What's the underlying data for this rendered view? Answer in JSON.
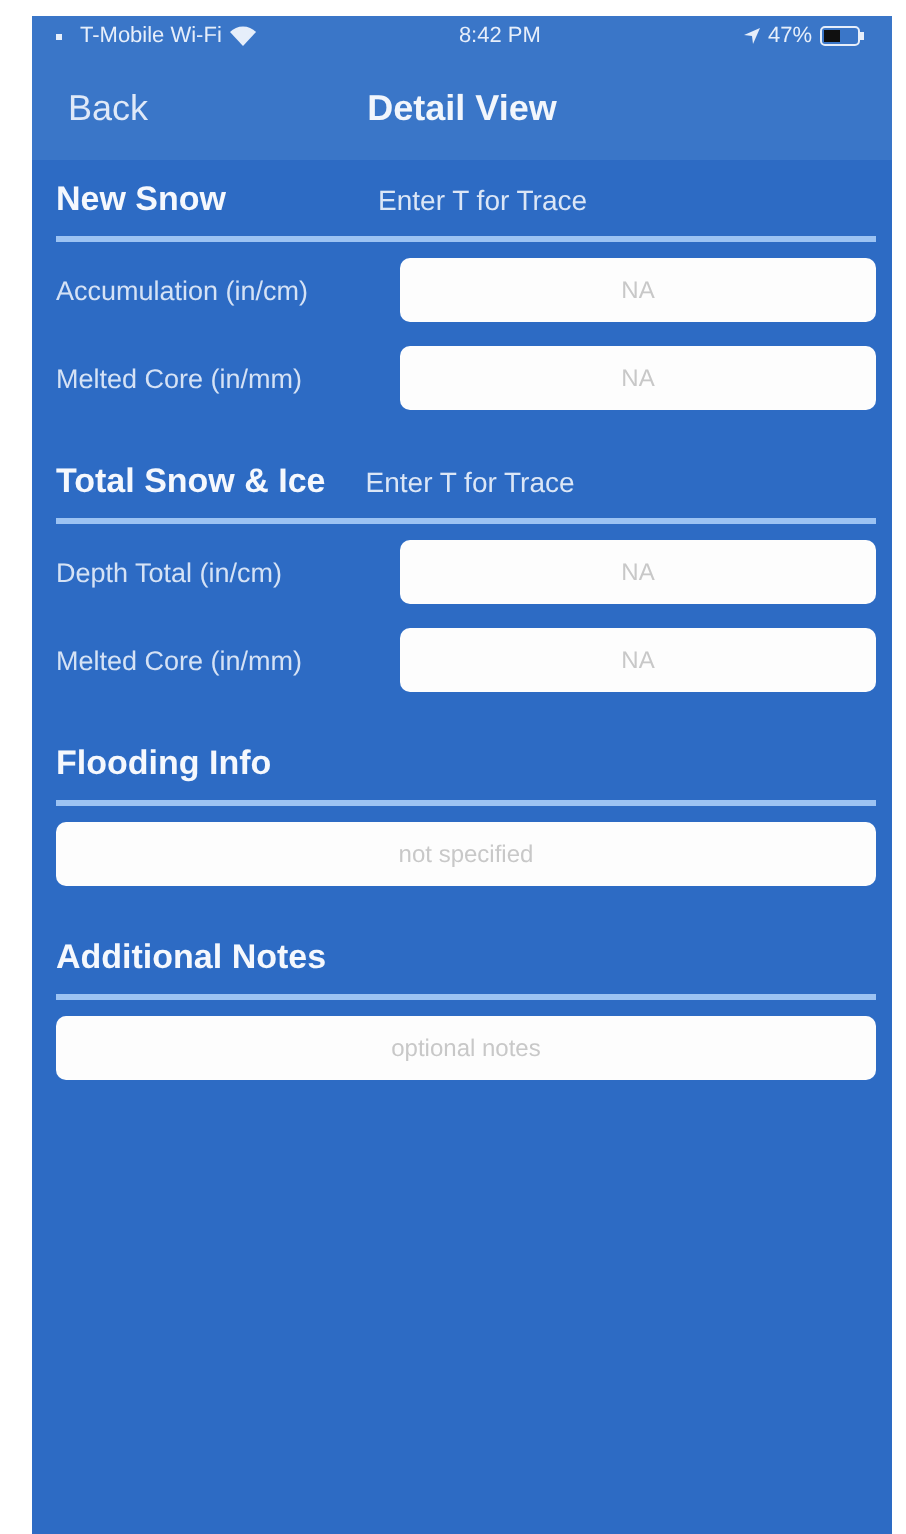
{
  "status_bar": {
    "carrier": "T-Mobile Wi-Fi",
    "time": "8:42 PM",
    "battery": "47%"
  },
  "nav": {
    "back": "Back",
    "title": "Detail View"
  },
  "sections": [
    {
      "title": "New Snow",
      "hint": "Enter T for Trace",
      "fields": [
        {
          "kind": "labeled",
          "label": "Accumulation (in/cm)",
          "placeholder": "NA"
        },
        {
          "kind": "labeled",
          "label": "Melted Core (in/mm)",
          "placeholder": "NA"
        }
      ]
    },
    {
      "title": "Total Snow & Ice",
      "hint": "Enter T for Trace",
      "fields": [
        {
          "kind": "labeled",
          "label": "Depth Total (in/cm)",
          "placeholder": "NA"
        },
        {
          "kind": "labeled",
          "label": "Melted Core (in/mm)",
          "placeholder": "NA"
        }
      ]
    },
    {
      "title": "Flooding Info",
      "fields": [
        {
          "kind": "full",
          "placeholder": "not specified"
        }
      ]
    },
    {
      "title": "Additional Notes",
      "fields": [
        {
          "kind": "full",
          "placeholder": "optional notes"
        }
      ]
    }
  ]
}
